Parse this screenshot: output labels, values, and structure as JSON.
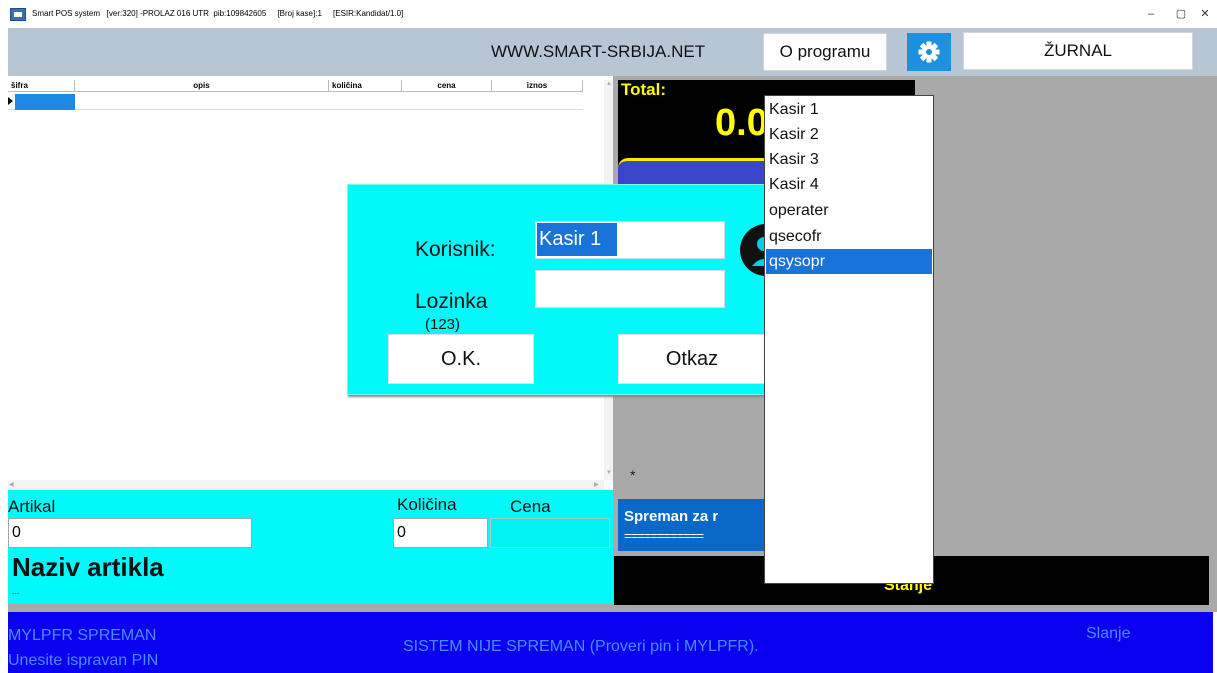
{
  "window": {
    "title": "Smart POS system   [ver:320] -PROLAZ 016 UTR  pib:109842605     [Broj kase]:1     [ESIR:Kandidat/1.0]",
    "minimize": "–",
    "maximize": "▢",
    "close": "✕"
  },
  "topbar": {
    "website": "WWW.SMART-SRBIJA.NET",
    "about_label": "O programu",
    "journal_label": "ŽURNAL"
  },
  "grid": {
    "columns": [
      "šifra",
      "opis",
      "količina",
      "cena",
      "iznos"
    ]
  },
  "entry": {
    "artikal_label": "Artikal",
    "artikal_value": "0",
    "kolicina_label": "Količina",
    "kolicina_value": "0",
    "cena_label": "Cena",
    "naziv_label": "Naziv artikla",
    "naziv_dots": "..."
  },
  "display": {
    "total_label": "Total:",
    "total_value": "0.0",
    "star": "*",
    "ready_text": "Spreman za r",
    "ready_eq": "============",
    "stanje_label": "Stanje"
  },
  "footer": {
    "mylpfr_status": "MYLPFR SPREMAN",
    "pin_prompt": "Unesite ispravan PIN",
    "system_status": "SISTEM NIJE SPREMAN (Proveri pin i MYLPFR).",
    "slanje_label": "Slanje"
  },
  "login": {
    "user_label": "Korisnik:",
    "user_value": "Kasir 1",
    "password_label": "Lozinka",
    "password_hint": "(123)",
    "ok_label": "O.K.",
    "cancel_label": "Otkaz"
  },
  "user_dropdown": {
    "items": [
      "Kasir 1",
      "Kasir 2",
      "Kasir 3",
      "Kasir 4",
      "operater",
      "qsecofr",
      "qsysopr"
    ],
    "selected": "qsysopr"
  },
  "colors": {
    "cyan_panel": "#00fafa",
    "footer_blue": "#0a00f0",
    "accent_blue": "#1a73d9",
    "total_yellow": "#ffff00"
  },
  "icons": {
    "settings": "gear-icon",
    "app": "app-icon",
    "user": "user-icon"
  }
}
